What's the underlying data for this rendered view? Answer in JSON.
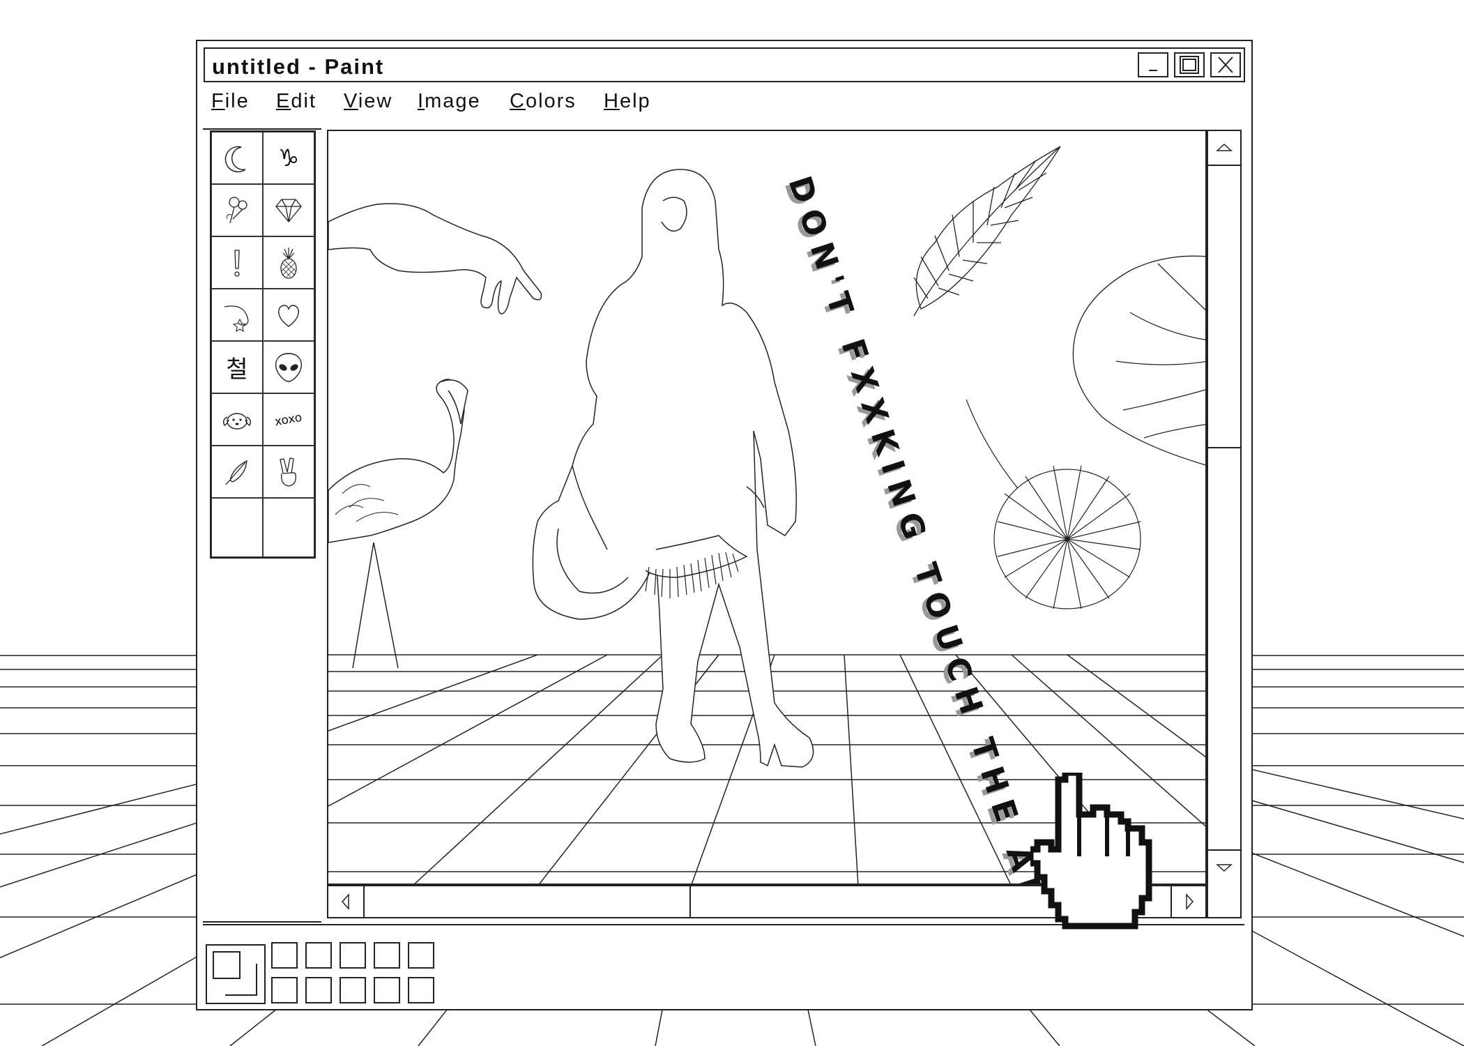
{
  "window": {
    "title": "untitled - Paint"
  },
  "menu": [
    {
      "first": "F",
      "rest": "ile"
    },
    {
      "first": "E",
      "rest": "dit"
    },
    {
      "first": "V",
      "rest": "iew"
    },
    {
      "first": "I",
      "rest": "mage"
    },
    {
      "first": "C",
      "rest": "olors"
    },
    {
      "first": "H",
      "rest": "elp"
    }
  ],
  "toolbox": {
    "tools": [
      {
        "icon": "crescent-moon-icon"
      },
      {
        "icon": "capricorn-icon"
      },
      {
        "icon": "rose-icon"
      },
      {
        "icon": "diamond-icon"
      },
      {
        "icon": "exclamation-icon"
      },
      {
        "icon": "pineapple-icon"
      },
      {
        "icon": "shooting-star-icon"
      },
      {
        "icon": "heart-icon"
      },
      {
        "icon": "korean-character-icon",
        "glyph": "철"
      },
      {
        "icon": "alien-icon"
      },
      {
        "icon": "puppy-icon"
      },
      {
        "icon": "xoxo-icon",
        "glyph": "xoxo"
      },
      {
        "icon": "feather-icon"
      },
      {
        "icon": "peace-hand-icon"
      },
      {
        "icon": "empty-tool"
      },
      {
        "icon": "empty-tool"
      }
    ]
  },
  "canvas": {
    "slogan": "DON'T FXXKING TOUCH THE ART"
  },
  "palette": {
    "swatch_count": 10
  }
}
